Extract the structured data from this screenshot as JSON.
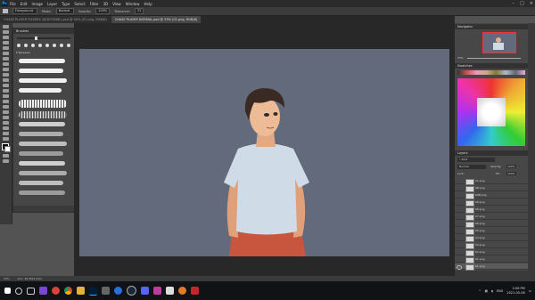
{
  "app": {
    "logo_text": "Ps"
  },
  "menu": [
    "File",
    "Edit",
    "Image",
    "Layer",
    "Type",
    "Select",
    "Filter",
    "3D",
    "View",
    "Window",
    "Help"
  ],
  "options_bar": {
    "tool_label": "Foreground",
    "mode_label": "Mode:",
    "mode_value": "Normal",
    "opacity_label": "Opacity:",
    "opacity_value": "100%",
    "tolerance_label": "Tolerance:",
    "tolerance_value": "32"
  },
  "tabs": [
    {
      "label": "CHASE PLAYER FIXSERS 3(EDITGNRL).psd @ 50% (01.png, RGB/8)",
      "active": false
    },
    {
      "label": "CHASE PLAYER NORMAL.psd @ 33% (01.png, RGB/8)",
      "active": true
    }
  ],
  "brushes_panel": {
    "title": "Brushes",
    "folder_label": "Sprayers"
  },
  "navigator": {
    "title": "Navigator",
    "zoom": "33%"
  },
  "swatches": {
    "title": "Swatches"
  },
  "layers_panel": {
    "title": "Layers",
    "kind_label": "Kind",
    "blend_mode": "Normal",
    "opacity_label": "Opacity:",
    "opacity_value": "100%",
    "lock_label": "Lock:",
    "fill_label": "Fill:",
    "fill_value": "100%",
    "layers": [
      "11.png",
      "9B.png",
      "09B.png",
      "08.png",
      "08.png",
      "07.png",
      "06.png",
      "05.png",
      "04.png",
      "03.png",
      "02.png",
      "01.png",
      "01.png"
    ]
  },
  "status_bar": {
    "zoom": "33%",
    "doc": "Doc: 28.3M/1.01G"
  },
  "taskbar": {
    "lang": "ENG",
    "time": "2:06 PM",
    "date": "2021-05-08"
  },
  "colors": {
    "canvas_bg": "#636a7b",
    "accent": "#31a8ff"
  }
}
